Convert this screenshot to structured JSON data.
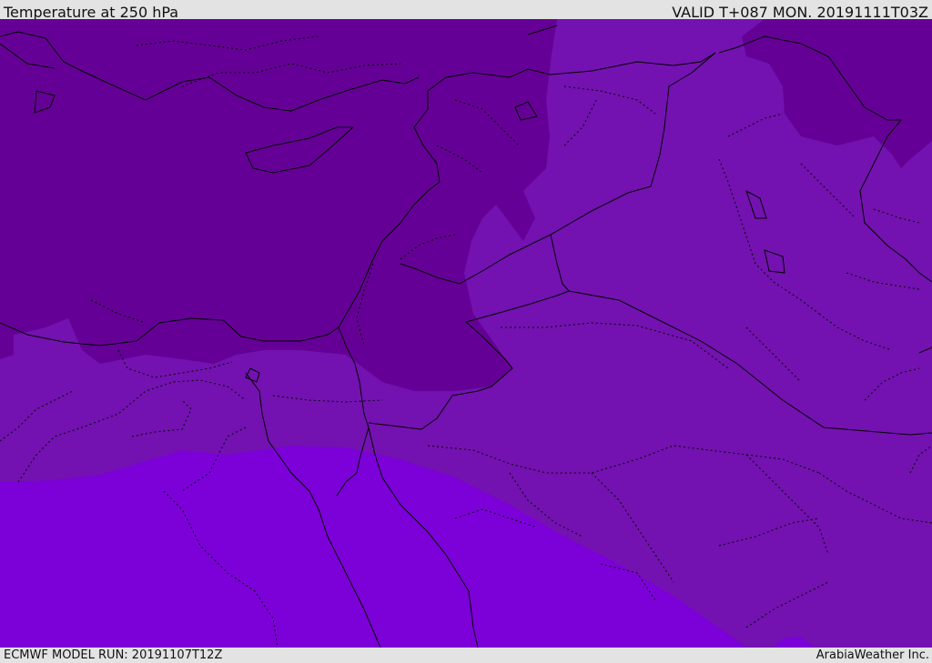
{
  "header": {
    "title": "Temperature at 250 hPa",
    "valid_time": "VALID T+087 MON. 20191111T03Z"
  },
  "footer": {
    "model_run": "ECMWF MODEL RUN: 20191107T12Z",
    "credit": "ArabiaWeather Inc."
  },
  "map": {
    "region": "Eastern Mediterranean and Middle East",
    "temperature_band_colors": {
      "coldest": "#650096",
      "middle": "#7312b0",
      "warmest": "#7c00d8"
    },
    "outline_color": "#000000"
  }
}
